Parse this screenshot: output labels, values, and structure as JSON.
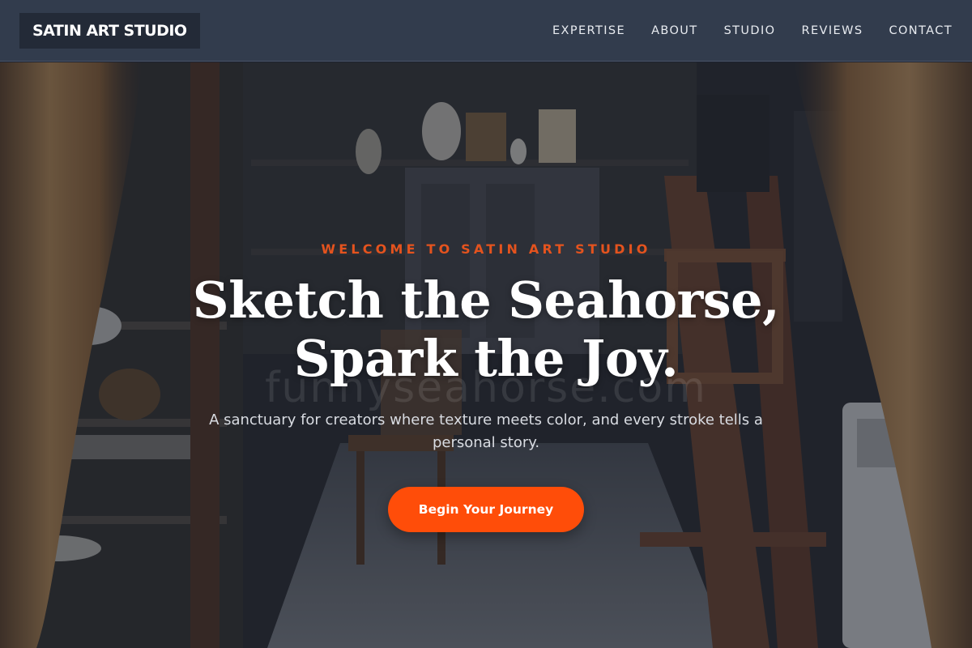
{
  "header": {
    "brand": "SATIN ART STUDIO",
    "nav": [
      {
        "label": "EXPERTISE"
      },
      {
        "label": "ABOUT"
      },
      {
        "label": "STUDIO"
      },
      {
        "label": "REVIEWS"
      },
      {
        "label": "CONTACT"
      }
    ]
  },
  "hero": {
    "eyebrow": "WELCOME TO SATIN ART STUDIO",
    "headline_line1": "Sketch the Seahorse,",
    "headline_line2": "Spark the Joy.",
    "subtitle": "A sanctuary for creators where texture meets color, and every stroke tells a personal story.",
    "cta_label": "Begin Your Journey",
    "watermark": "funnyseahorse.com"
  },
  "colors": {
    "navbar_bg": "#323c4d",
    "brand_bg": "#232a37",
    "accent": "#ff4d09",
    "eyebrow": "#e4531e"
  }
}
